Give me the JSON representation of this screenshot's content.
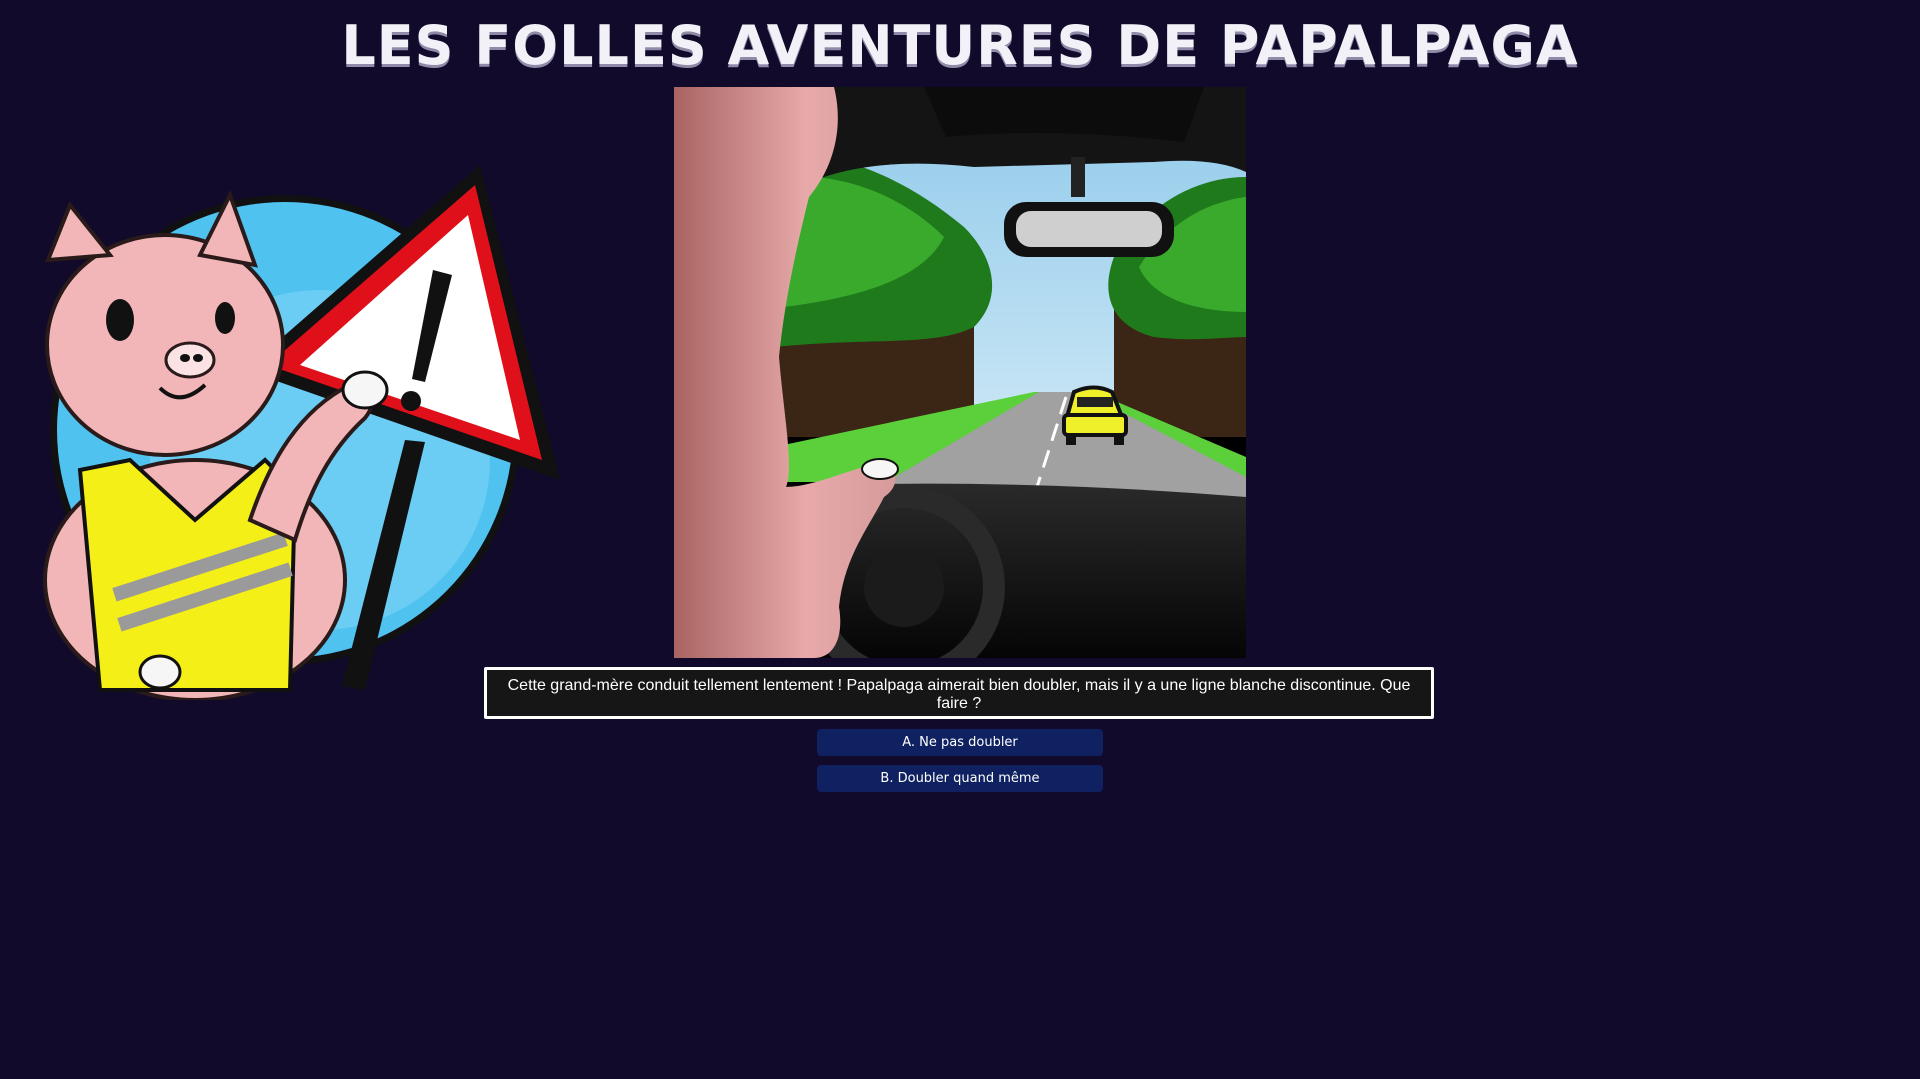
{
  "header": {
    "title": "Les folles aventures de Papalpaga"
  },
  "question": {
    "text": "Cette grand-mère conduit tellement lentement ! Papalpaga aimerait bien doubler, mais il y a une ligne blanche discontinue. Que faire ?"
  },
  "answers": [
    {
      "label": "A. Ne pas doubler"
    },
    {
      "label": "B. Doubler quand même"
    }
  ],
  "colors": {
    "background": "#110a2b",
    "button": "#0f2160",
    "question_box": "#161616",
    "question_border": "#ffffff"
  },
  "icons": {
    "mascot": "alpaca-with-warning-sign",
    "scene": "alpaca-driving-car-behind-yellow-car"
  }
}
